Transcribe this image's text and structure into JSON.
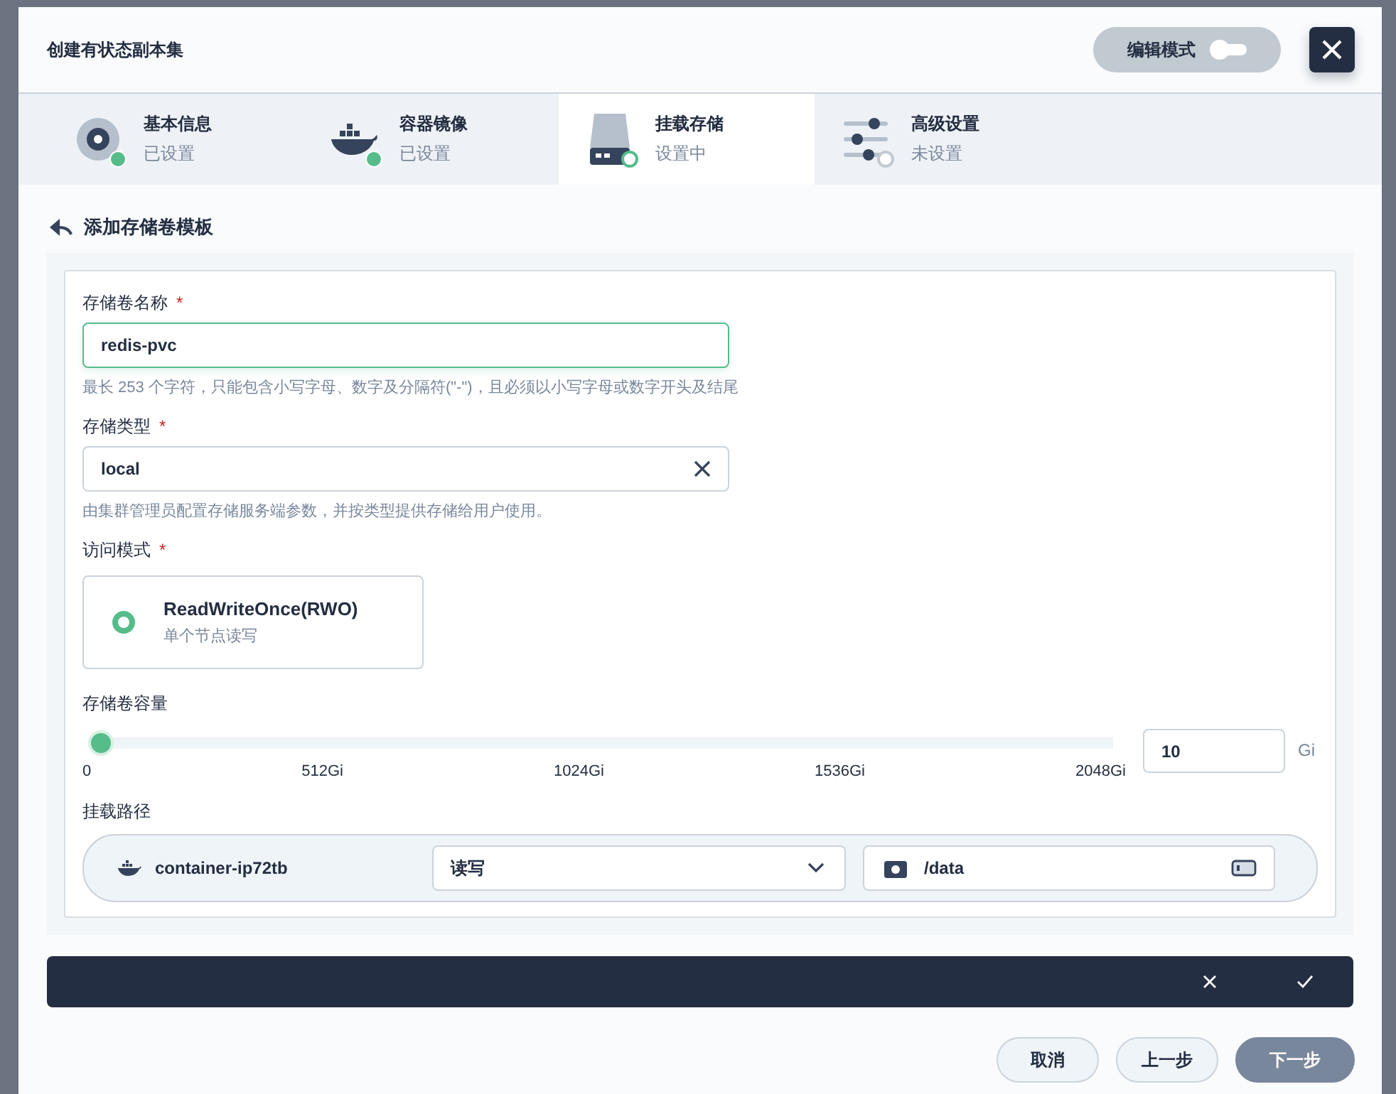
{
  "dialog": {
    "title": "创建有状态副本集",
    "edit_mode": {
      "label": "编辑模式",
      "on": false
    }
  },
  "steps": [
    {
      "kind": "disk",
      "title": "基本信息",
      "status_text": "已设置",
      "done": true,
      "selected": false
    },
    {
      "kind": "whale",
      "title": "容器镜像",
      "status_text": "已设置",
      "done": true,
      "selected": false
    },
    {
      "kind": "drive",
      "title": "挂载存储",
      "status_text": "设置中",
      "done": false,
      "selected": true
    },
    {
      "kind": "sliders",
      "title": "高级设置",
      "status_text": "未设置",
      "done": false,
      "selected": false
    }
  ],
  "back_link": "添加存储卷模板",
  "form": {
    "name": {
      "label": "存储卷名称",
      "required_mark": "*",
      "value": "redis-pvc",
      "hint": "最长 253 个字符，只能包含小写字母、数字及分隔符(\"-\")，且必须以小写字母或数字开头及结尾"
    },
    "storage_class": {
      "label": "存储类型",
      "required_mark": "*",
      "value": "local",
      "hint": "由集群管理员配置存储服务端参数，并按类型提供存储给用户使用。"
    },
    "access_mode": {
      "label": "访问模式",
      "required_mark": "*",
      "options": [
        {
          "title": "ReadWriteOnce(RWO)",
          "description": "单个节点读写",
          "selected": true
        }
      ]
    },
    "capacity": {
      "label": "存储卷容量",
      "level": 0.005,
      "ticks": [
        "0",
        "512Gi",
        "1024Gi",
        "1536Gi",
        "2048Gi"
      ],
      "value": "10",
      "unit": "Gi"
    },
    "mount": {
      "label": "挂载路径",
      "container": "container-ip72tb",
      "mode": "读写",
      "path": "/data"
    }
  },
  "footer": {
    "cancel": "取消",
    "previous": "上一步",
    "next": "下一步"
  }
}
